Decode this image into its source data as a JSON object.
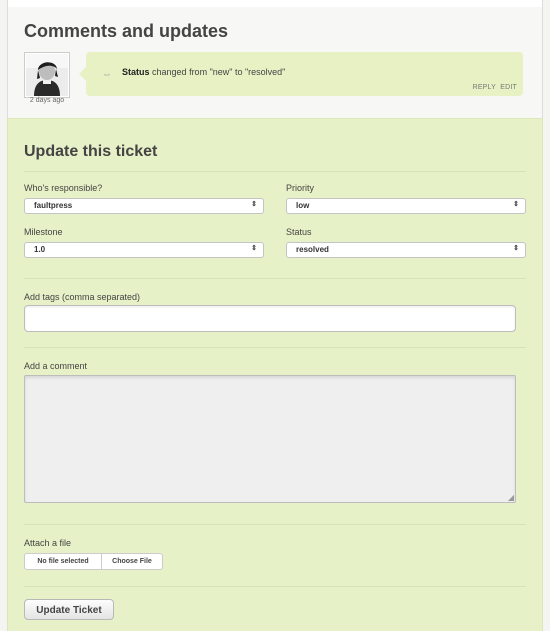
{
  "comments": {
    "title": "Comments and updates",
    "timestamp": "2 days ago",
    "entry": {
      "icon": "change-arrows-icon",
      "field": "Status",
      "text": "changed from \"new\" to \"resolved\"",
      "reply_label": "REPLY",
      "edit_label": "EDIT"
    }
  },
  "update": {
    "title": "Update this ticket",
    "responsible": {
      "label": "Who's responsible?",
      "value": "faultpress"
    },
    "priority": {
      "label": "Priority",
      "value": "low"
    },
    "milestone": {
      "label": "Milestone",
      "value": "1.0"
    },
    "status": {
      "label": "Status",
      "value": "resolved"
    },
    "tags": {
      "label": "Add tags (comma separated)",
      "value": ""
    },
    "comment": {
      "label": "Add a comment",
      "value": ""
    },
    "file": {
      "label": "Attach a file",
      "status": "No file selected",
      "choose_label": "Choose File"
    },
    "submit_label": "Update Ticket"
  },
  "colors": {
    "panel_bg": "#e7f1c7",
    "bubble_bg": "#e7f1c3"
  }
}
